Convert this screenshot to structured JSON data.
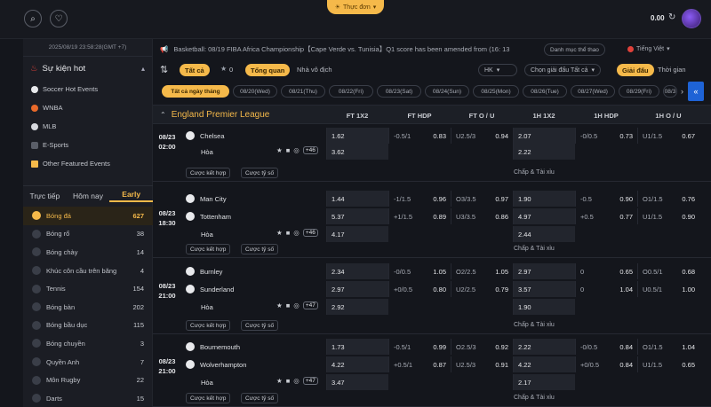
{
  "header": {
    "menu_label": "Thực đơn",
    "balance": "0.00"
  },
  "sidebar": {
    "datetime": "2025/08/19 23:58:28(GMT +7)",
    "hot_title": "Sự kiện hot",
    "hot_items": [
      "Soccer Hot Events",
      "WNBA",
      "MLB",
      "E-Sports",
      "Other Featured Events"
    ],
    "tabs": [
      "Trực tiếp",
      "Hôm nay",
      "Early"
    ],
    "sports": [
      {
        "name": "Bóng đá",
        "count": "627"
      },
      {
        "name": "Bóng rổ",
        "count": "38"
      },
      {
        "name": "Bóng chày",
        "count": "14"
      },
      {
        "name": "Khúc côn cầu trên băng",
        "count": "4"
      },
      {
        "name": "Tennis",
        "count": "154"
      },
      {
        "name": "Bóng bàn",
        "count": "202"
      },
      {
        "name": "Bóng bầu dục",
        "count": "115"
      },
      {
        "name": "Bóng chuyền",
        "count": "3"
      },
      {
        "name": "Quyền Anh",
        "count": "7"
      },
      {
        "name": "Môn Rugby",
        "count": "22"
      },
      {
        "name": "Darts",
        "count": "15"
      }
    ]
  },
  "ticker": {
    "text": "Basketball: 08/19 FIBA Africa Championship【Cape Verde vs. Tunisia】Q1 score has been amended from (16: 13",
    "sport_list": "Danh mục thể thao",
    "lang": "Tiếng Việt"
  },
  "filter": {
    "all": "Tất cả",
    "fav_count": "0",
    "overview": "Tổng quan",
    "home_pick": "Nhà vô địch",
    "odds_type": "HK",
    "league_select": "Chọn giải đấu Tất cả",
    "by_league": "Giải đấu",
    "by_time": "Thời gian"
  },
  "dates": [
    "Tất cả ngày tháng",
    "08/20(Wed)",
    "08/21(Thu)",
    "08/22(Fri)",
    "08/23(Sat)",
    "08/24(Sun)",
    "08/25(Mon)",
    "08/26(Tue)",
    "08/27(Wed)",
    "08/29(Fri)",
    "08/3"
  ],
  "table": {
    "league": "England Premier League",
    "columns": [
      "FT 1X2",
      "FT HDP",
      "FT O / U",
      "1H 1X2",
      "1H HDP",
      "1H O / U"
    ],
    "draw_label": "Hòa",
    "btn_result": "Cược kết hợp",
    "btn_score": "Cược tỷ số",
    "handicap_link": "Chấp & Tài xỉu",
    "matches": [
      {
        "date": "08/23",
        "time": "02:00",
        "home": "Chelsea",
        "away": "",
        "more": "+46",
        "ft1x2": [
          "1.62",
          "",
          "3.62"
        ],
        "fthdp": [
          [
            "-0.5/1",
            "0.83"
          ]
        ],
        "ftou": [
          [
            "U2.5/3",
            "0.94"
          ]
        ],
        "h1x2": [
          "2.07",
          "",
          "2.22"
        ],
        "hhdp": [
          [
            "-0/0.5",
            "0.73"
          ]
        ],
        "hou": [
          [
            "U1/1.5",
            "0.67"
          ]
        ]
      },
      {
        "date": "08/23",
        "time": "18:30",
        "home": "Man City",
        "away": "Tottenham",
        "more": "+46",
        "ft1x2": [
          "1.44",
          "5.37",
          "4.17"
        ],
        "fthdp": [
          [
            "-1/1.5",
            "0.96"
          ],
          [
            "+1/1.5",
            "0.89"
          ]
        ],
        "ftou": [
          [
            "O3/3.5",
            "0.97"
          ],
          [
            "U3/3.5",
            "0.86"
          ]
        ],
        "h1x2": [
          "1.90",
          "4.97",
          "2.44"
        ],
        "hhdp": [
          [
            "-0.5",
            "0.90"
          ],
          [
            "+0.5",
            "0.77"
          ]
        ],
        "hou": [
          [
            "O1/1.5",
            "0.76"
          ],
          [
            "U1/1.5",
            "0.90"
          ]
        ]
      },
      {
        "date": "08/23",
        "time": "21:00",
        "home": "Burnley",
        "away": "Sunderland",
        "more": "+47",
        "ft1x2": [
          "2.34",
          "2.97",
          "2.92"
        ],
        "fthdp": [
          [
            "-0/0.5",
            "1.05"
          ],
          [
            "+0/0.5",
            "0.80"
          ]
        ],
        "ftou": [
          [
            "O2/2.5",
            "1.05"
          ],
          [
            "U2/2.5",
            "0.79"
          ]
        ],
        "h1x2": [
          "2.97",
          "3.57",
          "1.90"
        ],
        "hhdp": [
          [
            "0",
            "0.65"
          ],
          [
            "0",
            "1.04"
          ]
        ],
        "hou": [
          [
            "O0.5/1",
            "0.68"
          ],
          [
            "U0.5/1",
            "1.00"
          ]
        ]
      },
      {
        "date": "08/23",
        "time": "21:00",
        "home": "Bournemouth",
        "away": "Wolverhampton",
        "more": "+47",
        "ft1x2": [
          "1.73",
          "4.22",
          "3.47"
        ],
        "fthdp": [
          [
            "-0.5/1",
            "0.99"
          ],
          [
            "+0.5/1",
            "0.87"
          ]
        ],
        "ftou": [
          [
            "O2.5/3",
            "0.92"
          ],
          [
            "U2.5/3",
            "0.91"
          ]
        ],
        "h1x2": [
          "2.22",
          "4.22",
          "2.17"
        ],
        "hhdp": [
          [
            "-0/0.5",
            "0.84"
          ],
          [
            "+0/0.5",
            "0.84"
          ]
        ],
        "hou": [
          [
            "O1/1.5",
            "1.04"
          ],
          [
            "U1/1.5",
            "0.65"
          ]
        ]
      }
    ]
  },
  "colors": {
    "accent": "#f5b94a",
    "bg": "#14161c",
    "side_tab": "#1e63d6"
  }
}
